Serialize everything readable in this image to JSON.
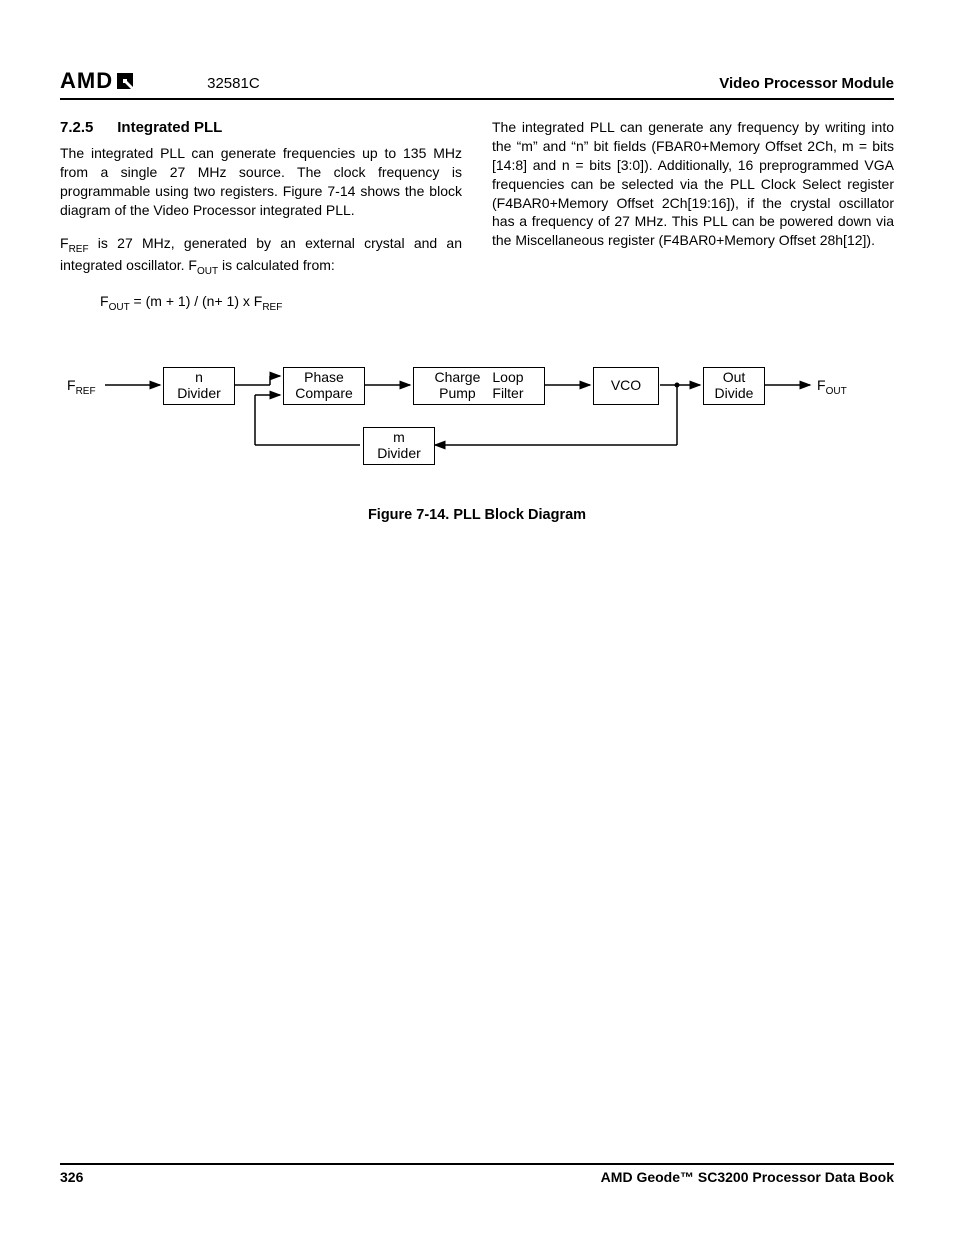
{
  "header": {
    "logo_text": "AMD",
    "docnum": "32581C",
    "right": "Video Processor Module"
  },
  "section": {
    "number": "7.2.5",
    "title": "Integrated PLL"
  },
  "left": {
    "p1": "The integrated PLL can generate frequencies up to 135 MHz from a single 27 MHz source. The clock frequency is programmable using two registers. Figure 7-14 shows the block diagram of the Video Processor integrated PLL.",
    "p2a": "F",
    "p2b": " is 27 MHz, generated by an external crystal and an integrated oscillator. F",
    "p2c": " is calculated from:",
    "formula_a": "F",
    "formula_b": " = (m + 1) / (n+ 1) x F"
  },
  "right": {
    "p1": "The integrated PLL can generate any frequency by writing into the “m” and “n” bit fields (FBAR0+Memory Offset 2Ch, m = bits [14:8] and n = bits [3:0]). Additionally, 16 preprogrammed VGA frequencies can be selected via the PLL Clock Select register (F4BAR0+Memory Offset 2Ch[19:16]), if the crystal oscillator has a frequency of 27 MHz. This PLL can be powered down via the Miscellaneous register (F4BAR0+Memory Offset 28h[12])."
  },
  "diagram": {
    "fref": "F",
    "fref_sub": "REF",
    "fout": "F",
    "fout_sub": "OUT",
    "n_divider_l1": "n",
    "n_divider_l2": "Divider",
    "phase_l1": "Phase",
    "phase_l2": "Compare",
    "charge_l1": "Charge",
    "charge_l2": "Pump",
    "loop_l1": "Loop",
    "loop_l2": "Filter",
    "vco": "VCO",
    "out_l1": "Out",
    "out_l2": "Divide",
    "m_l1": "m",
    "m_l2": "Divider"
  },
  "figure": {
    "caption": "Figure 7-14.  PLL Block Diagram"
  },
  "footer": {
    "page": "326",
    "book": "AMD Geode™ SC3200 Processor Data Book"
  },
  "sub": {
    "ref": "REF",
    "out": "OUT"
  }
}
